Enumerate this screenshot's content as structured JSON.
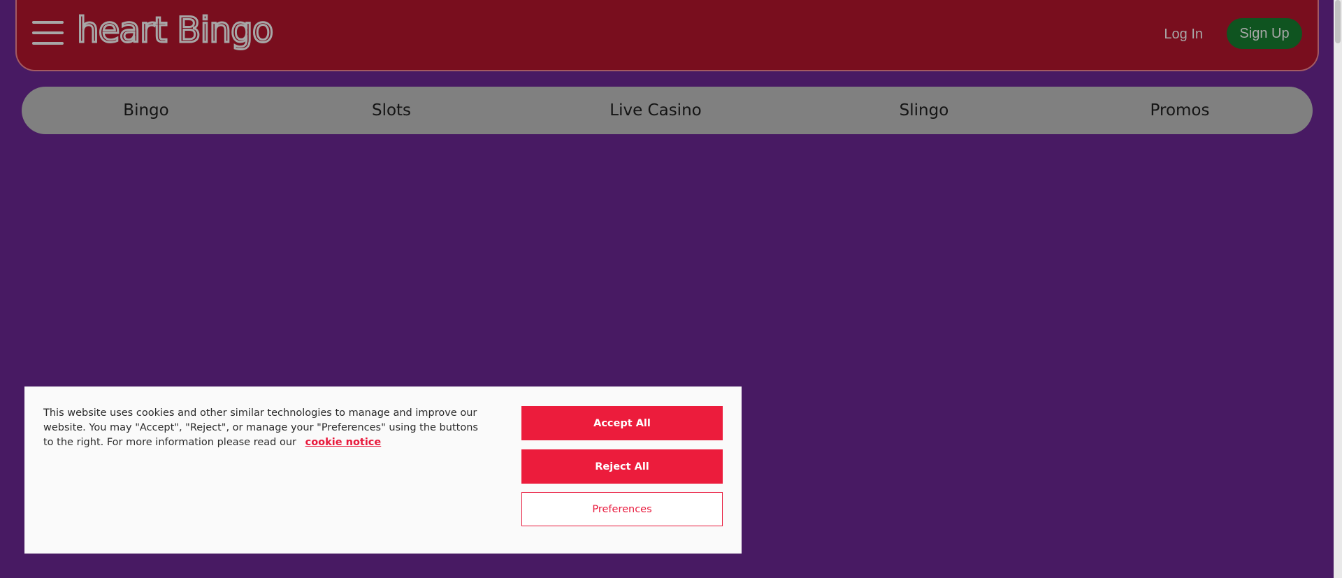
{
  "header": {
    "logo_text": "heart Bingo",
    "login_label": "Log In",
    "signup_label": "Sign Up",
    "menu_icon": "hamburger-menu-icon"
  },
  "nav": {
    "items": [
      {
        "label": "Bingo"
      },
      {
        "label": "Slots"
      },
      {
        "label": "Live Casino"
      },
      {
        "label": "Slingo"
      },
      {
        "label": "Promos"
      }
    ]
  },
  "cookie_banner": {
    "text": "This website uses cookies and other similar technologies to manage and improve our website. You may \"Accept\", \"Reject\", or manage your \"Preferences\" using the buttons to the right. For more information please read our",
    "link_label": "cookie notice",
    "accept_label": "Accept All",
    "reject_label": "Reject All",
    "preferences_label": "Preferences"
  },
  "colors": {
    "page_background": "#481a63",
    "header_background": "#790e1e",
    "nav_background": "#808080",
    "signup_background": "#0f5420",
    "accent_red": "#ec1c3c"
  }
}
